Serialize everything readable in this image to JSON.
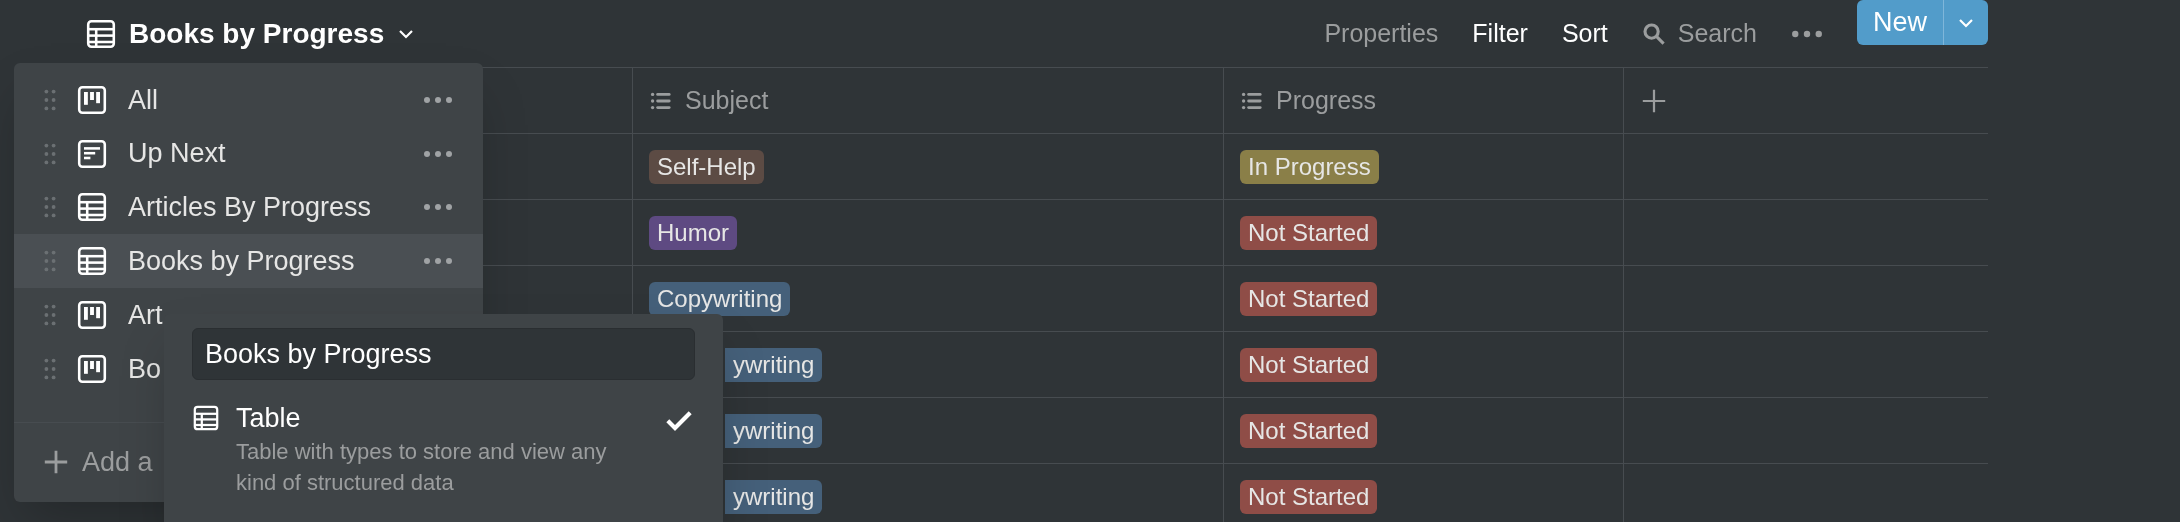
{
  "toolbar": {
    "title": "Books by Progress",
    "actions": [
      {
        "label": "Properties",
        "emphasis": false
      },
      {
        "label": "Filter",
        "emphasis": true
      },
      {
        "label": "Sort",
        "emphasis": true
      }
    ],
    "search": "Search",
    "new_button": "New"
  },
  "table": {
    "columns": [
      {
        "label": "Subject"
      },
      {
        "label": "Progress"
      }
    ],
    "rows": [
      {
        "subject": {
          "text": "Self-Help",
          "color": "#5c4b44",
          "partial": false
        },
        "progress": {
          "text": "In Progress",
          "color": "#8a7f48"
        }
      },
      {
        "subject": {
          "text": "Humor",
          "color": "#5e4a82",
          "partial": false
        },
        "progress": {
          "text": "Not Started",
          "color": "#8f4d47"
        }
      },
      {
        "subject": {
          "text": "Copywriting",
          "color": "#45607a",
          "partial": false
        },
        "progress": {
          "text": "Not Started",
          "color": "#8f4d47"
        }
      },
      {
        "subject": {
          "text": "ywriting",
          "color": "#45607a",
          "partial": true
        },
        "progress": {
          "text": "Not Started",
          "color": "#8f4d47"
        }
      },
      {
        "subject": {
          "text": "ywriting",
          "color": "#45607a",
          "partial": true
        },
        "progress": {
          "text": "Not Started",
          "color": "#8f4d47"
        }
      },
      {
        "subject": {
          "text": "ywriting",
          "color": "#45607a",
          "partial": true
        },
        "progress": {
          "text": "Not Started",
          "color": "#8f4d47"
        }
      }
    ]
  },
  "views_menu": {
    "items": [
      {
        "label": "All",
        "kind": "board",
        "selected": false,
        "more_button": true
      },
      {
        "label": "Up Next",
        "kind": "list",
        "selected": false,
        "more_button": true
      },
      {
        "label": "Articles By Progress",
        "kind": "table",
        "selected": false,
        "more_button": true
      },
      {
        "label": "Books by Progress",
        "kind": "table",
        "selected": true,
        "more_button": true
      },
      {
        "label": "Art",
        "kind": "board",
        "selected": false,
        "more_button": false
      },
      {
        "label": "Bo",
        "kind": "board",
        "selected": false
      }
    ],
    "add": "Add a"
  },
  "rename_popover": {
    "value": "Books by Progress",
    "options": [
      {
        "label": "Table",
        "description": "Table with types to store and view any kind of structured data",
        "selected": true
      }
    ]
  }
}
